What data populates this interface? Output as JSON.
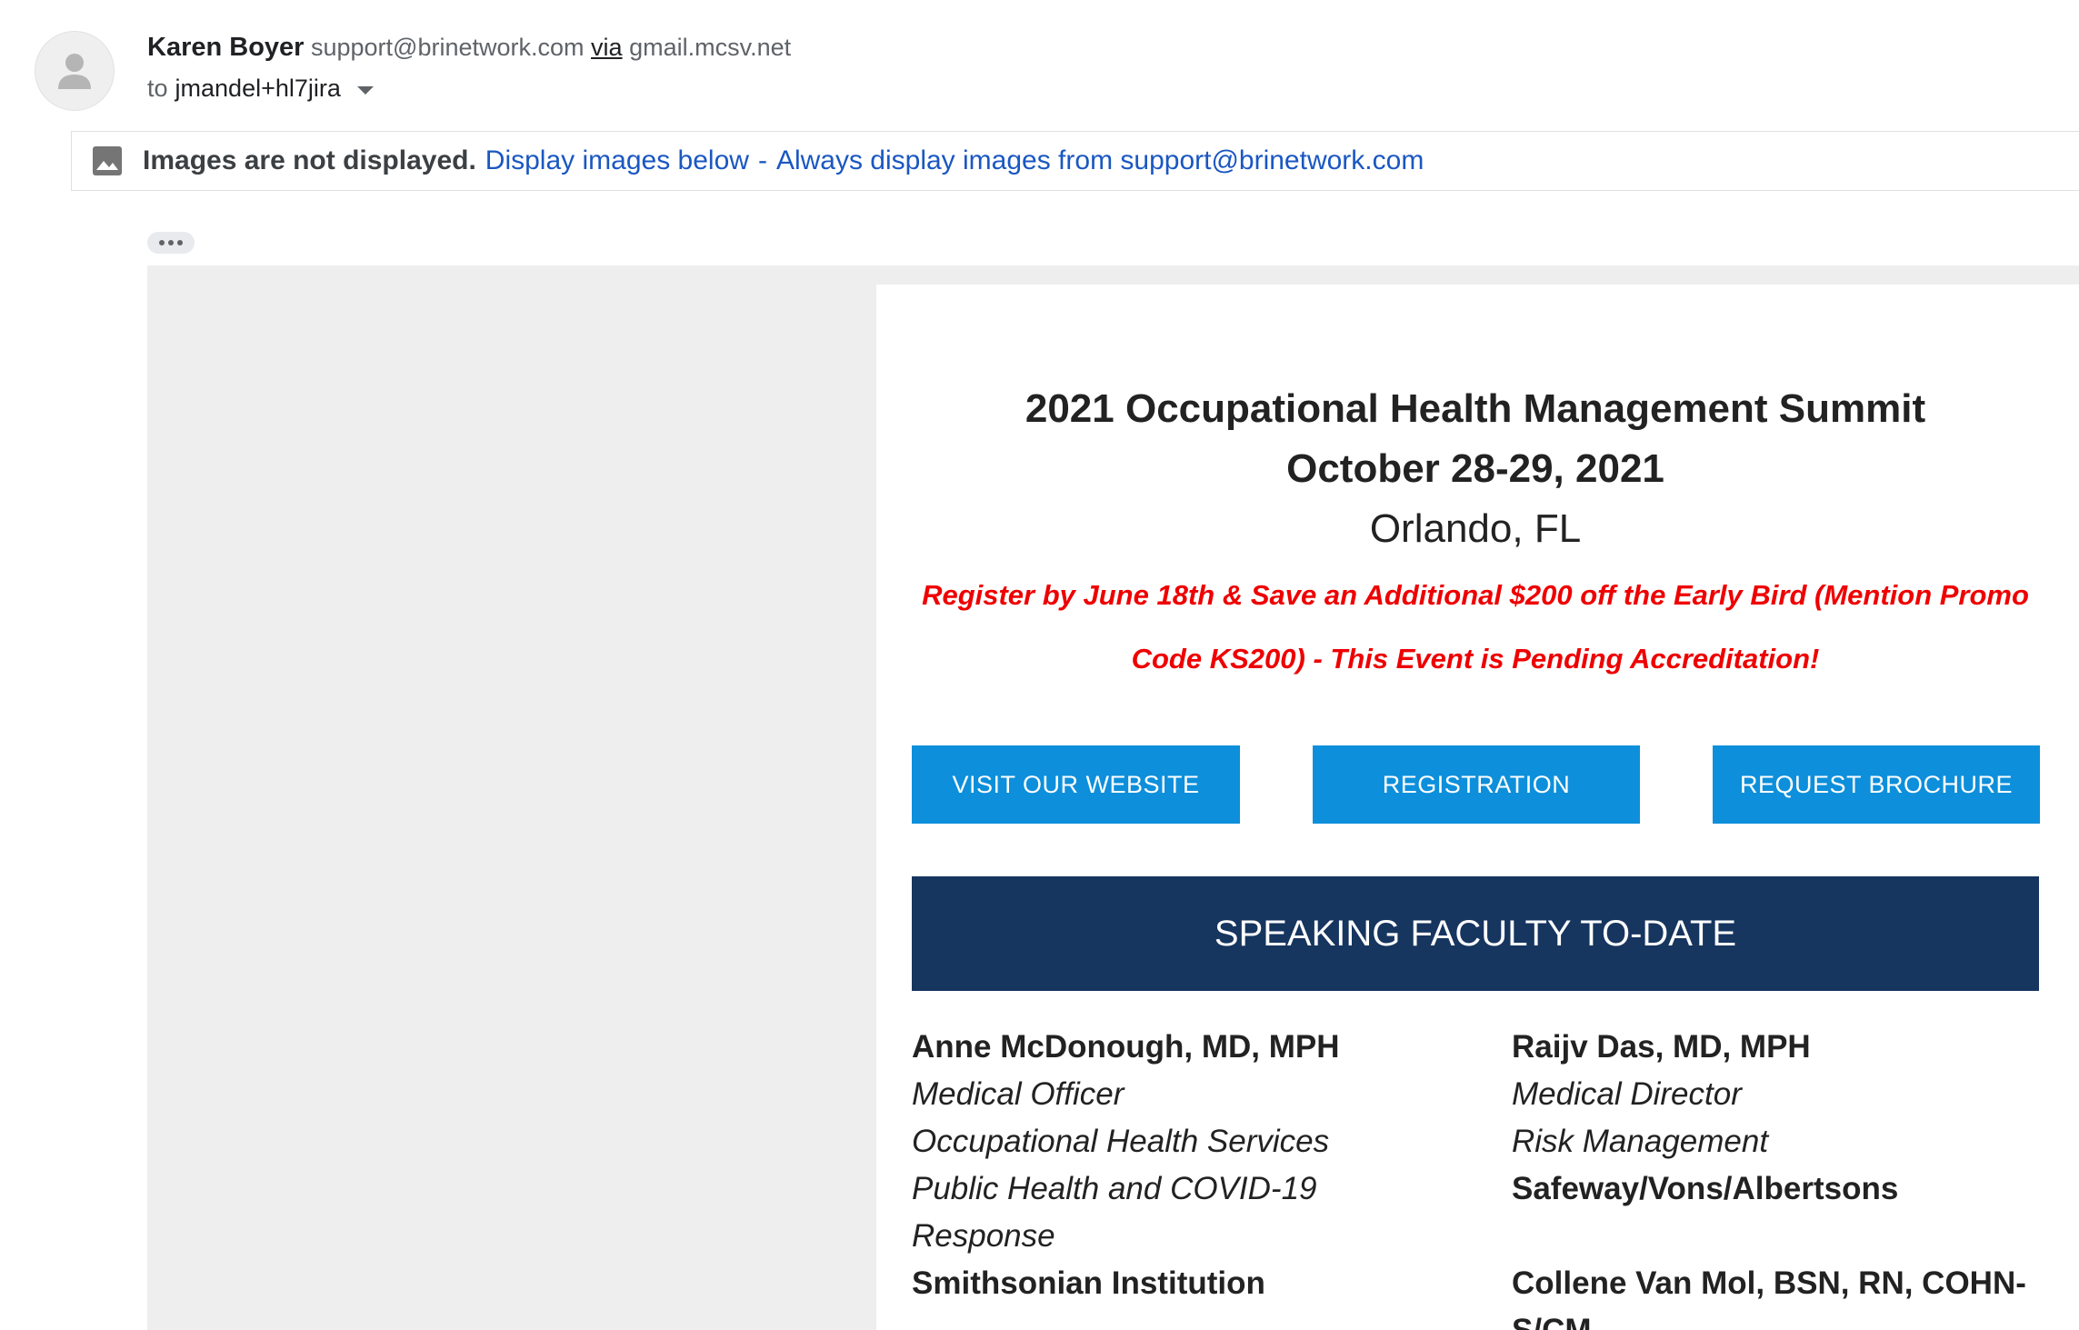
{
  "header": {
    "sender_name": "Karen Boyer",
    "sender_email": "support@brinetwork.com",
    "via_label": "via",
    "via_domain": "gmail.mcsv.net",
    "to_label": "to",
    "recipient": "jmandel+hl7jira"
  },
  "images_banner": {
    "notice": "Images are not displayed.",
    "display_below_link": "Display images below",
    "separator": "-",
    "always_display_link": "Always display images from support@brinetwork.com"
  },
  "email": {
    "title_line1": "2021 Occupational Health Management Summit",
    "title_line2": "October 28-29, 2021",
    "location": "Orlando, FL",
    "promo_text": "Register by June 18th & Save an Additional $200 off the Early Bird (Mention Promo Code KS200) - This Event is Pending Accreditation!",
    "buttons": {
      "website": "VISIT OUR WEBSITE",
      "registration": "REGISTRATION",
      "brochure": "REQUEST BROCHURE"
    },
    "faculty_heading": "SPEAKING FACULTY TO-DATE",
    "speakers": {
      "left": {
        "name": "Anne McDonough, MD, MPH",
        "title1": "Medical Officer",
        "title2": "Occupational Health Services",
        "title3": "Public Health and COVID-19 Response",
        "org": "Smithsonian Institution"
      },
      "right": {
        "name": "Raijv Das, MD, MPH",
        "title1": "Medical Director",
        "title2": "Risk Management",
        "org": "Safeway/Vons/Albertsons",
        "next_name": "Collene Van Mol, BSN, RN, COHN-S/CM"
      }
    }
  },
  "colors": {
    "link": "#1a57c2",
    "promo_red": "#ee0000",
    "button_blue": "#0d8fdb",
    "banner_navy": "#16355f"
  }
}
